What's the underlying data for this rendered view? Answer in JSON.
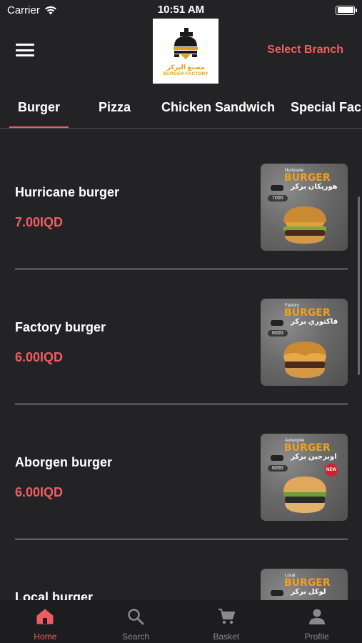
{
  "status_bar": {
    "carrier": "Carrier",
    "time": "10:51 AM"
  },
  "header": {
    "logo_ar": "مصنع البركر",
    "logo_en": "BURGER FACTORY",
    "select_branch": "Select Branch"
  },
  "tabs": [
    {
      "label": "Burger"
    },
    {
      "label": "Pizza"
    },
    {
      "label": "Chicken Sandwich"
    },
    {
      "label": "Special Fac"
    }
  ],
  "items": [
    {
      "name": "Hurricane burger",
      "price": "7.00IQD",
      "img_small": "Hurricane",
      "img_word": "BURGER",
      "img_ar": "هوريكان بركر",
      "img_price": "7000"
    },
    {
      "name": "Factory burger",
      "price": "6.00IQD",
      "img_small": "Factory",
      "img_word": "BURGER",
      "img_ar": "فاكتوري بركر",
      "img_price": "6000"
    },
    {
      "name": "Aborgen burger",
      "price": "6.00IQD",
      "img_small": "Aubergine",
      "img_word": "BURGER",
      "img_ar": "اوبرجين بركر",
      "img_price": "6000",
      "badge": "NEW"
    },
    {
      "name": "Local burger",
      "price": "",
      "img_small": "Local",
      "img_word": "BURGER",
      "img_ar": "لوكل بركر",
      "img_price": ""
    }
  ],
  "nav": [
    {
      "label": "Home",
      "icon": "home-icon"
    },
    {
      "label": "Search",
      "icon": "search-icon"
    },
    {
      "label": "Basket",
      "icon": "cart-icon"
    },
    {
      "label": "Profile",
      "icon": "profile-icon"
    }
  ],
  "colors": {
    "accent": "#ef5d63",
    "background": "#232325",
    "logo_gold": "#e0a112"
  }
}
